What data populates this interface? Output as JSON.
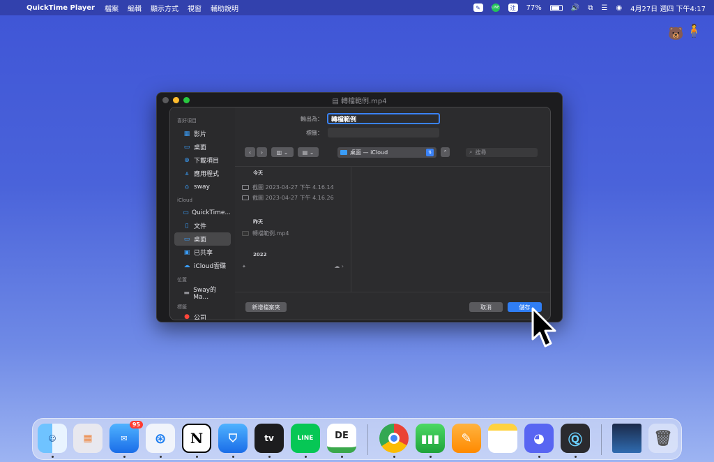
{
  "menubar": {
    "apple_icon": "apple-icon",
    "app_name": "QuickTime Player",
    "items": [
      "檔案",
      "編輯",
      "顯示方式",
      "視窗",
      "輔助說明"
    ],
    "input_method": "注",
    "battery": "77%",
    "datetime": "4月27日 週四 下午4:17"
  },
  "window": {
    "title": "轉檔範例.mp4"
  },
  "save_dialog": {
    "export_as_label": "輸出為：",
    "export_as_value": "轉檔範例",
    "tags_label": "標籤：",
    "tags_value": "",
    "location": "桌面 — iCloud",
    "search_placeholder": "搜尋",
    "new_folder_button": "新增檔案夾",
    "cancel_button": "取消",
    "save_button": "儲存"
  },
  "sidebar": {
    "favorites_header": "喜好項目",
    "favorites": [
      {
        "label": "影片",
        "icon": "movie-icon"
      },
      {
        "label": "桌面",
        "icon": "desktop-icon"
      },
      {
        "label": "下載項目",
        "icon": "download-icon"
      },
      {
        "label": "應用程式",
        "icon": "apps-icon"
      },
      {
        "label": "sway",
        "icon": "home-icon"
      }
    ],
    "icloud_header": "iCloud",
    "icloud": [
      {
        "label": "QuickTime...",
        "icon": "folder-icon"
      },
      {
        "label": "文件",
        "icon": "document-icon"
      },
      {
        "label": "桌面",
        "icon": "desktop-icon"
      },
      {
        "label": "已共享",
        "icon": "shared-icon"
      },
      {
        "label": "iCloud雲碟",
        "icon": "cloud-icon"
      }
    ],
    "locations_header": "位置",
    "locations": [
      {
        "label": "Sway的 Ma...",
        "icon": "laptop-icon"
      }
    ],
    "tags_header": "標籤",
    "tags_partial": "公司"
  },
  "browser": {
    "groups": [
      {
        "header": "今天",
        "files": [
          "截圖 2023-04-27 下午 4.16.14",
          "截圖 2023-04-27 下午 4.16.26"
        ]
      },
      {
        "header": "昨天",
        "files": [
          "轉檔範例.mp4"
        ]
      },
      {
        "header": "2022",
        "files": [
          ""
        ]
      }
    ]
  },
  "dock": {
    "apps": [
      "Finder",
      "Launchpad",
      "Mail",
      "Safari",
      "Notion",
      "Keynote",
      "Apple TV",
      "LINE",
      "DE",
      "Chrome",
      "Numbers",
      "Pages",
      "Notes",
      "Discord",
      "QuickTime",
      "Photos",
      "Trash"
    ],
    "mail_badge": "95",
    "tv_label": "tv",
    "line_label": "LINE",
    "de_label": "DE",
    "notion_label": "N"
  },
  "colors": {
    "accent": "#2f7ef5",
    "dialog_bg": "#2c2c2e"
  }
}
